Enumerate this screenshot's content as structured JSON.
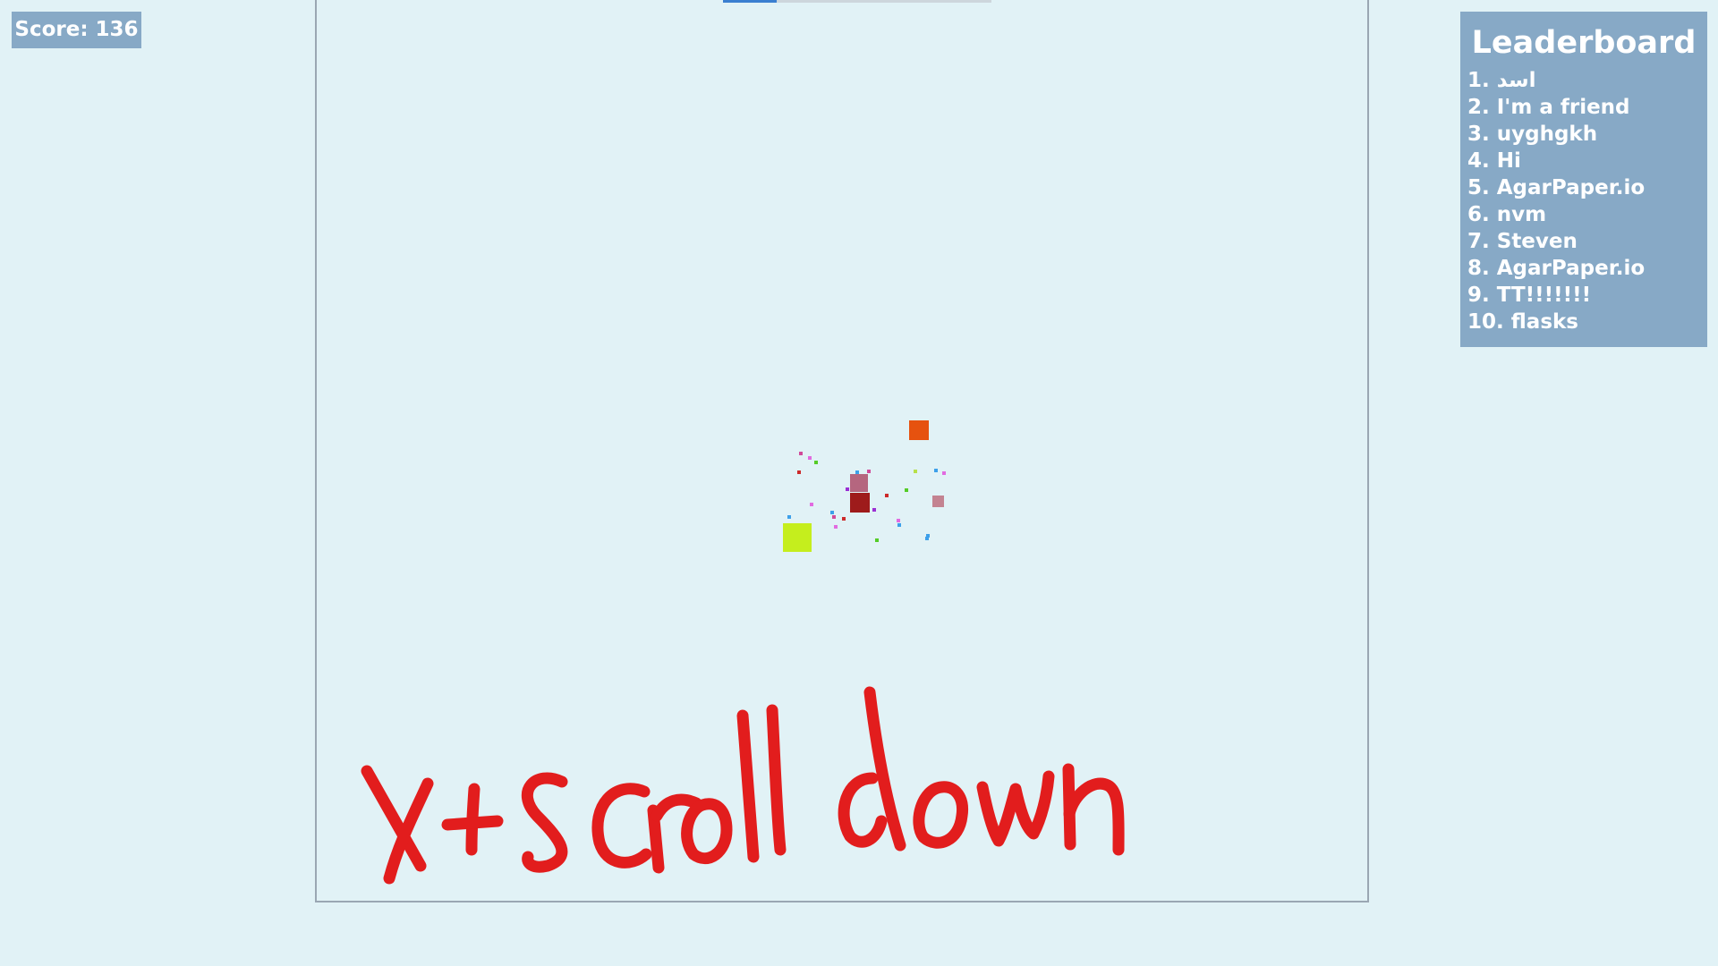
{
  "score": {
    "label": "Score: 136"
  },
  "top_bar": {
    "progress": 0.2
  },
  "leaderboard": {
    "title": "Leaderboard",
    "entries": [
      "1. اسد",
      "2. I'm a friend",
      "3. uyghgkh",
      "4. Hi",
      "5. AgarPaper.io",
      "6. nvm",
      "7. Steven",
      "8. AgarPaper.io",
      "9. TT!!!!!!!",
      "10. flasks"
    ]
  },
  "players": [
    {
      "color": "#e6520f",
      "name": ""
    },
    {
      "color": "#b5667f",
      "name": ""
    },
    {
      "color": "#9e1b1b",
      "name": ""
    },
    {
      "color": "#c38391",
      "name": ""
    },
    {
      "color": "#c5ee1d",
      "name": ""
    }
  ],
  "pellet_colors": [
    "#3da0ea",
    "#9b2fd4",
    "#cc2a2a",
    "#54cc27",
    "#e16be0",
    "#b7e04a",
    "#d04b9a"
  ],
  "annotation": {
    "text": "X+Scroll down",
    "color": "#e21d1d"
  }
}
